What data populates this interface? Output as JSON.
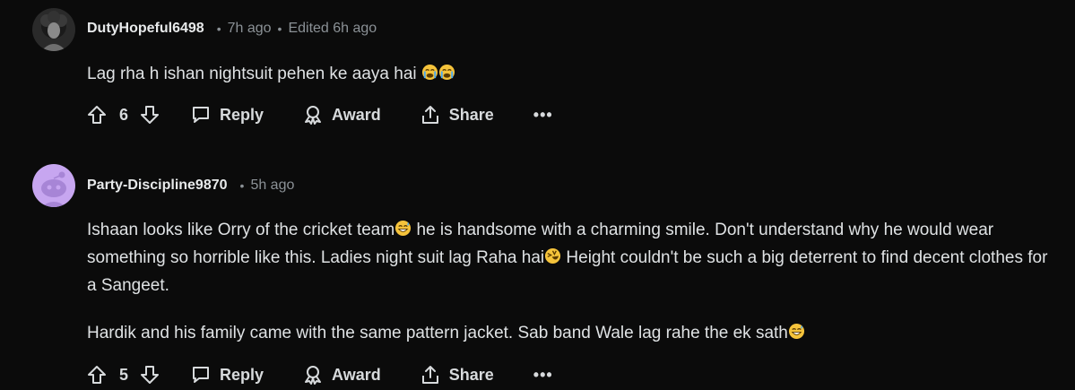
{
  "comments": [
    {
      "username": "DutyHopeful6498",
      "time": "7h ago",
      "edited": "Edited 6h ago",
      "body": [
        "Lag rha h ishan nightsuit pehen ke aaya hai"
      ],
      "votes": "6",
      "reply": "Reply",
      "award": "Award",
      "share": "Share",
      "more": "•••"
    },
    {
      "username": "Party-Discipline9870",
      "time": "5h ago",
      "body_p1_a": "Ishaan looks like Orry of the cricket team",
      "body_p1_b": " he is handsome with a charming smile. Don't understand why he would wear something so horrible like this. Ladies night suit lag Raha hai",
      "body_p1_c": " Height couldn't be such a big deterrent to find decent clothes for a Sangeet.",
      "body_p2": "Hardik and his family came with the same pattern jacket. Sab band Wale lag rahe the ek sath",
      "votes": "5",
      "reply": "Reply",
      "award": "Award",
      "share": "Share",
      "more": "•••"
    }
  ],
  "colors": {
    "background": "#0b0b0b",
    "text": "#d7dadc",
    "muted": "#8b9196",
    "avatar2_bg": "#c7a6f0"
  },
  "icons": [
    "upvote-icon",
    "downvote-icon",
    "comment-icon",
    "award-icon",
    "share-icon",
    "crying-emoji",
    "grinning-sweat-emoji",
    "rofl-emoji"
  ]
}
